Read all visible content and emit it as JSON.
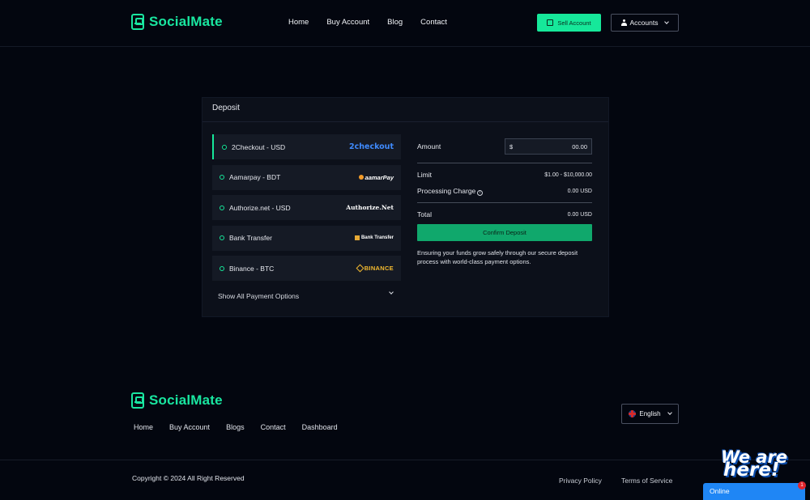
{
  "header": {
    "brand": "SocialMate",
    "nav": [
      "Home",
      "Buy Account",
      "Blog",
      "Contact"
    ],
    "sell_label": "Sell Account",
    "accounts_label": "Accounts"
  },
  "deposit": {
    "title": "Deposit",
    "methods": [
      {
        "label": "2Checkout - USD",
        "logo_text": "2checkout",
        "active": true
      },
      {
        "label": "Aamarpay - BDT",
        "logo_text": "aamarPay",
        "active": false
      },
      {
        "label": "Authorize.net - USD",
        "logo_text": "Authorize.Net",
        "active": false
      },
      {
        "label": "Bank Transfer",
        "logo_text": "Bank Transfer",
        "active": false
      },
      {
        "label": "Binance - BTC",
        "logo_text": "BINANCE",
        "active": false
      }
    ],
    "show_all_label": "Show All Payment Options",
    "amount_label": "Amount",
    "currency_symbol": "$",
    "amount_placeholder": "00.00",
    "limit_label": "Limit",
    "limit_value": "$1.00 - $10,000.00",
    "charge_label": "Processing Charge",
    "charge_value": "0.00 USD",
    "total_label": "Total",
    "total_value": "0.00 USD",
    "confirm_label": "Confirm Deposit",
    "note": "Ensuring your funds grow safely through our secure deposit process with world-class payment options."
  },
  "footer": {
    "brand": "SocialMate",
    "nav": [
      "Home",
      "Buy Account",
      "Blogs",
      "Contact",
      "Dashboard"
    ],
    "language": "English",
    "copyright": "Copyright © 2024 All Right Reserved",
    "privacy": "Privacy Policy",
    "terms": "Terms of Service"
  },
  "chat": {
    "art_line1": "We are",
    "art_line2": "here!",
    "status": "Online",
    "badge": "1"
  },
  "colors": {
    "accent": "#16e89a",
    "background": "#03060f",
    "card": "#0c101a",
    "chat": "#1f86f5"
  }
}
